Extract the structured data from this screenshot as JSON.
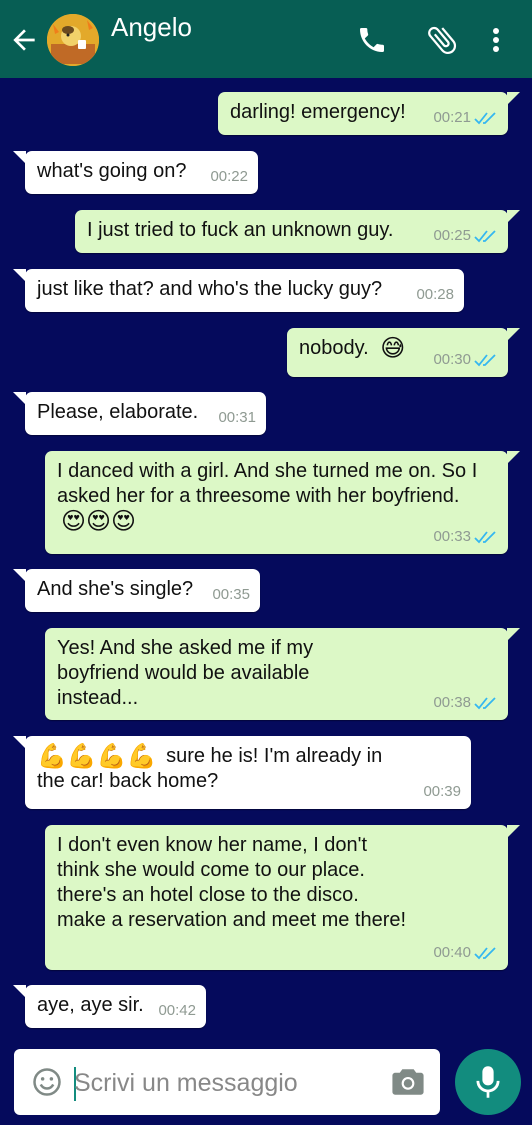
{
  "header": {
    "contact_name": "Angelo",
    "icons": [
      "back-arrow-icon",
      "avatar",
      "phone-icon",
      "paperclip-icon",
      "more-vert-icon"
    ]
  },
  "colors": {
    "header": "#075e54",
    "chat_background": "#050a5c",
    "outgoing_bubble": "#dcf8c6",
    "incoming_bubble": "#ffffff",
    "read_ticks": "#34b7f1",
    "accent": "#128c7e"
  },
  "messages": [
    {
      "dir": "out",
      "text": "darling! emergency!",
      "time": "00:21",
      "read": true
    },
    {
      "dir": "in",
      "text": "what's going on?",
      "time": "00:22"
    },
    {
      "dir": "out",
      "text": "I just tried to fuck an unknown guy.",
      "time": "00:25",
      "read": true
    },
    {
      "dir": "in",
      "text": "just like that? and who's the lucky guy?",
      "time": "00:28"
    },
    {
      "dir": "out",
      "text": "nobody.",
      "emoji": "😅",
      "time": "00:30",
      "read": true
    },
    {
      "dir": "in",
      "text": "Please, elaborate.",
      "time": "00:31"
    },
    {
      "dir": "out",
      "text": "I danced with a girl. And she turned me on. So I asked her for a threesome with her boyfriend.",
      "emoji": "😍😍😍",
      "time": "00:33",
      "read": true
    },
    {
      "dir": "in",
      "text": "And she's single?",
      "time": "00:35"
    },
    {
      "dir": "out",
      "text": "Yes! And she asked me if my boyfriend would be available instead...",
      "time": "00:38",
      "read": true
    },
    {
      "dir": "in",
      "emoji": "💪💪💪💪",
      "text": "sure he is! I'm already in the car! back home?",
      "time": "00:39"
    },
    {
      "dir": "out",
      "text": "I don't even know her name, I don't think she would come to our place. there's an hotel close to the disco. make a reservation and meet me there!",
      "time": "00:40",
      "read": true
    },
    {
      "dir": "in",
      "text": "aye, aye sir.",
      "time": "00:42"
    }
  ],
  "composer": {
    "placeholder": "Scrivi un messaggio",
    "icons": [
      "smiley-icon",
      "camera-icon",
      "mic-icon"
    ]
  }
}
